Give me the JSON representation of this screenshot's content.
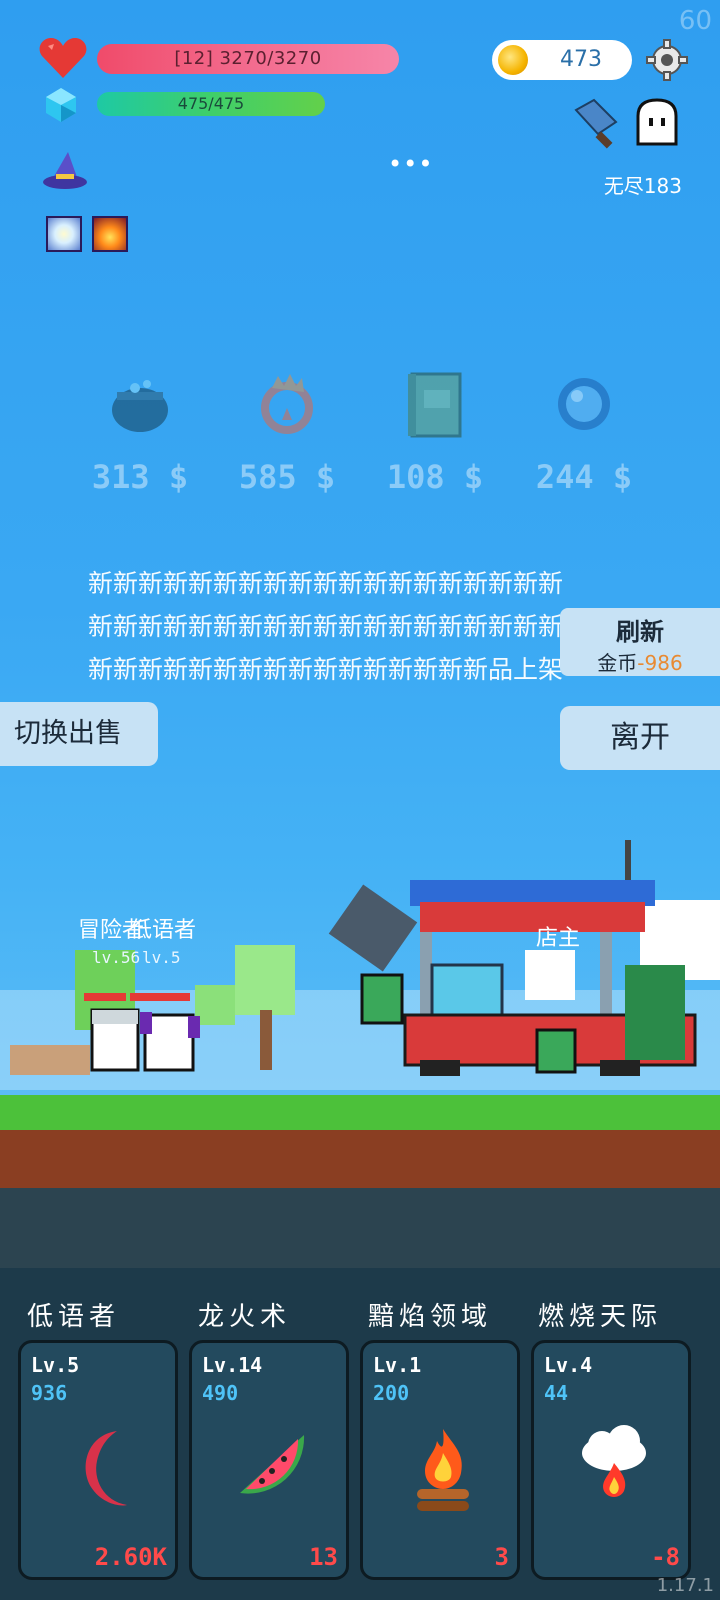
{
  "fps": "60",
  "hud": {
    "hp_text": "[12] 3270/3270",
    "mp_text": "475/475",
    "coins": "473",
    "endless_label": "无尽183",
    "menu_dots": "•••"
  },
  "shop": {
    "items": [
      {
        "icon": "cauldron-icon",
        "price": "313 $"
      },
      {
        "icon": "fire-ring-icon",
        "price": "585 $"
      },
      {
        "icon": "spell-book-icon",
        "price": "108 $"
      },
      {
        "icon": "blue-orb-icon",
        "price": "244 $"
      }
    ],
    "notice": "新新新新新新新新新新新新新新新新新新新新新新新新新新新新新新新新新新新新新新新新新新新新新新新新新新新新新新品上架",
    "refresh_label": "刷新",
    "refresh_cost_label": "金币",
    "refresh_cost_value": "-986",
    "leave_label": "离开",
    "switch_label": "切换出售"
  },
  "scene": {
    "hero1_name": "冒险者",
    "hero2_name": "低语者",
    "hero1_lv": "lv.56",
    "hero2_lv": "lv.5",
    "shop_owner_label": "店主"
  },
  "skills": [
    {
      "name": "低语者",
      "level": "Lv.5",
      "value": "936",
      "icon": "crescent-moon-icon",
      "bottom": "2.60K"
    },
    {
      "name": "龙火术",
      "level": "Lv.14",
      "value": "490",
      "icon": "watermelon-icon",
      "bottom": "13"
    },
    {
      "name": "黯焰领域",
      "level": "Lv.1",
      "value": "200",
      "icon": "campfire-icon",
      "bottom": "3"
    },
    {
      "name": "燃烧天际",
      "level": "Lv.4",
      "value": "44",
      "icon": "fire-cloud-icon",
      "bottom": "-8"
    }
  ],
  "version": "1.17.1",
  "colors": {
    "sky": "#2f9ef0",
    "hp_bar": "#f04b6a",
    "mp_bar": "#3fcf6a",
    "button_bg": "#c7e2f5",
    "card_bg": "#234a5e",
    "card_value": "#4fc3f7",
    "card_bottom": "#ff4a4a"
  }
}
